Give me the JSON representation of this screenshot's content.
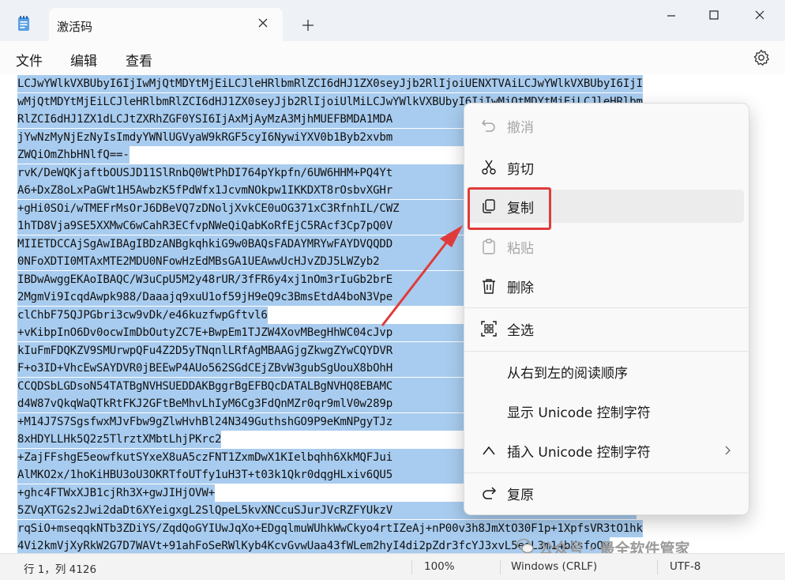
{
  "window": {
    "tab_title": "激活码",
    "new_tab_symbol": "+",
    "minimize_icon": "minimize-icon",
    "maximize_icon": "maximize-icon",
    "close_icon": "close-icon"
  },
  "menubar": {
    "items": [
      "文件",
      "编辑",
      "查看"
    ],
    "settings_icon": "gear-icon"
  },
  "editor": {
    "lines": [
      "LCJwYWlkVXBUbyI6IjIwMjQtMDYtMjEiLCJleHRlbmRlZCI6dHJ1ZX0seyJjb2RlIjoiUENXTVAiLCJwYWlkVXBUbyI6IjI",
      "wMjQtMDYtMjEiLCJleHRlbmRlZCI6dHJ1ZX0seyJjb2RlIjoiUlMiLCJwYWlkVXBUbyI6IjIwMjQtMDYtMjEiLCJleHRlbm",
      "RlZCI6dHJ1ZX1dLCJtZXRhZGF0YSI6IjAxMjAyMzA3MjhMUEFBMDA1MDA                                    5O",
      "jYwNzMyNjEzNyIsImdyYWNlUGVyaW9kRGF5cyI6NywiYXV0b1Byb2xvbm                                   2F0",
      "ZWQiOmZhbHNlfQ==-",
      "rvK/DeWQKjaftbOUSJD11SlRnbQ0WtPhDI764pYkpfn/6UW6HHM+PQ4Yt                                   2aY",
      "A6+DxZ8oLxPaGWt1H5AwbzK5fPdWfx1JcvmNOkpw1IKKDXT8rOsbvXGHr                                      ",
      "+gHi0SOi/wTMEFrMsOrJ6DBeVQ7zDNoljXvkCE0uOG371xC3RfnhIL/CWZ                                    ",
      "1hTD8Vja9SE5XXMwC6wCahR3ECfvpNWeQiQabKoRfEjC5RAcf3Cp7pQ0V                                     ",
      "MIIETDCCAjSgAwIBAgIBDzANBgkqhkiG9w0BAQsFADAYMRYwFAYDVQQDD                                   MDU",
      "0NFoXDTI0MTAxMTE2MDU0NFowHzEdMBsGA1UEAwwUcHJvZDJ5LWZyb2                                     AA4",
      "IBDwAwggEKAoIBAQC/W3uCpU5M2y48rUR/3fFR6y4xj1nOm3rIuGb2brE                                    Ds",
      "2MgmVi9IcqdAwpk988/Daaajq9xuU1of59jH9eQ9c3BmsEtdA4boN3Vpe                                    Zc",
      "clChbF75QJPGbri3cw9vDk/e46kuzfwpGftvl6",
      "+vKibpInO6Dv0ocwImDbOutyZC7E+BwpEm1TJZW4XovMBegHhWC04cJvp                                   Rc",
      "kIuFmFDQKZV9SMUrwpQFu4Z2D5yTNqnlLRfAgMBAAGjgZkwgZYwCQYDVR                                   eZ",
      "F+o3ID+VhcEwSAYDVR0jBEEwP4AUo562SGdCEjZBvW3gubSgUouX8bOhH                                   0G",
      "CCQDSbLGDsoN54TATBgNVHSUEDDAKBggrBgEFBQcDATALBgNVHQ8EBAMC                                   Ki",
      "d4W87vQkqWaQTkRtFKJ2GFtBeMhvLhIyM6Cg3FdQnMZr0qr9mlV0w289p                                      ",
      "+M14J7S7SgsfwxMJvFbw9gZlwHvhBl24N349GuthshGO9P9eKmNPgyTJz                                   rg",
      "8xHDYLLHk5Q2z5TlrztXMbtLhjPKrc2",
      "+ZajFFshgE5eowfkutSYxeX8uA5czFNT1ZxmDwX1KIelbqhh6XkMQFJui                                   11",
      "AlMKO2x/1hoKiHBU3oU3OKRTfoUTfy1uH3T+t03k1Qkr0dqgHLxiv6QU5                                      ",
      "+ghc4FTWxXJB1cjRh3X+gwJIHjOVW+",
      "5ZVqXTG2s2Jwi2daDt6XYeigxgL2SlQpeL5kvXNCcuSJurJVcRZFYUkzV                                   2T",
      "rqSiO+mseqqkNTb3ZDiYS/ZqdQoGYIUwJqXo+EDgqlmuWUhkWwCkyo4rtIZeAj+nP00v3h8JmXtO30F1p+1XpfsVR3tO1hk",
      "4Vi2kmVjXyRkW2G7D7WAVt+91ahFoSeRWlKyb4KcvGvwUaa43fWLem2hyI4di2pZdr3fcYJ3xvL5ejL3m14bKsfoOv"
    ]
  },
  "context_menu": {
    "items": [
      {
        "label": "撤消",
        "icon": "undo-icon",
        "disabled": true
      },
      {
        "label": "剪切",
        "icon": "cut-icon",
        "disabled": false
      },
      {
        "label": "复制",
        "icon": "copy-icon",
        "disabled": false,
        "highlighted": true
      },
      {
        "label": "粘贴",
        "icon": "paste-icon",
        "disabled": true
      },
      {
        "label": "删除",
        "icon": "delete-icon",
        "disabled": false
      },
      {
        "label": "全选",
        "icon": "select-all-icon",
        "disabled": false
      },
      {
        "label": "从右到左的阅读顺序",
        "icon": "",
        "disabled": false
      },
      {
        "label": "显示 Unicode 控制字符",
        "icon": "",
        "disabled": false
      },
      {
        "label": "插入 Unicode 控制字符",
        "icon": "insert-caret-icon",
        "disabled": false,
        "has_submenu": true
      },
      {
        "label": "复原",
        "icon": "restore-icon",
        "disabled": false
      }
    ],
    "highlight_color": "#e03b3b"
  },
  "statusbar": {
    "position": "行 1，列 4126",
    "zoom": "100%",
    "line_ending": "Windows (CRLF)",
    "encoding": "UTF-8"
  },
  "watermark": {
    "text": "公众号 · 最全软件管家"
  },
  "colors": {
    "selection": "#a8ccef",
    "annotation": "#e03b3b"
  }
}
